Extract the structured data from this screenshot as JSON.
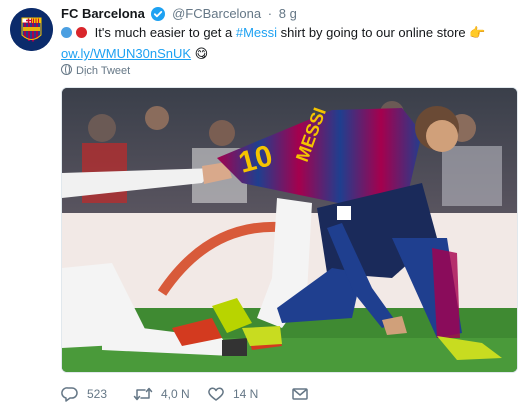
{
  "tweet": {
    "display_name": "FC Barcelona",
    "handle": "@FCBarcelona",
    "separator": "·",
    "time": "8 g",
    "text_part1": "It's much easier to get a ",
    "hashtag": "#Messi",
    "text_part2": " shirt by going to our online store ",
    "pointing_emoji": "👉",
    "link": "ow.ly/WMUN30nSnUK",
    "yum_emoji": "😋",
    "translate_label": "Dịch Tweet",
    "dot_colors": [
      "#4b9fe1",
      "#d9262b"
    ]
  },
  "actions": {
    "replies": "523",
    "retweets": "4,0 N",
    "likes": "14 N"
  },
  "colors": {
    "link": "#1da1f2",
    "secondary_text": "#657786",
    "verified_badge": "#1da1f2",
    "barca_blue": "#1f3f8f",
    "barca_red": "#a5004d",
    "pitch_green": "#3f8a32"
  },
  "media": {
    "description_icon": "football-photo"
  }
}
